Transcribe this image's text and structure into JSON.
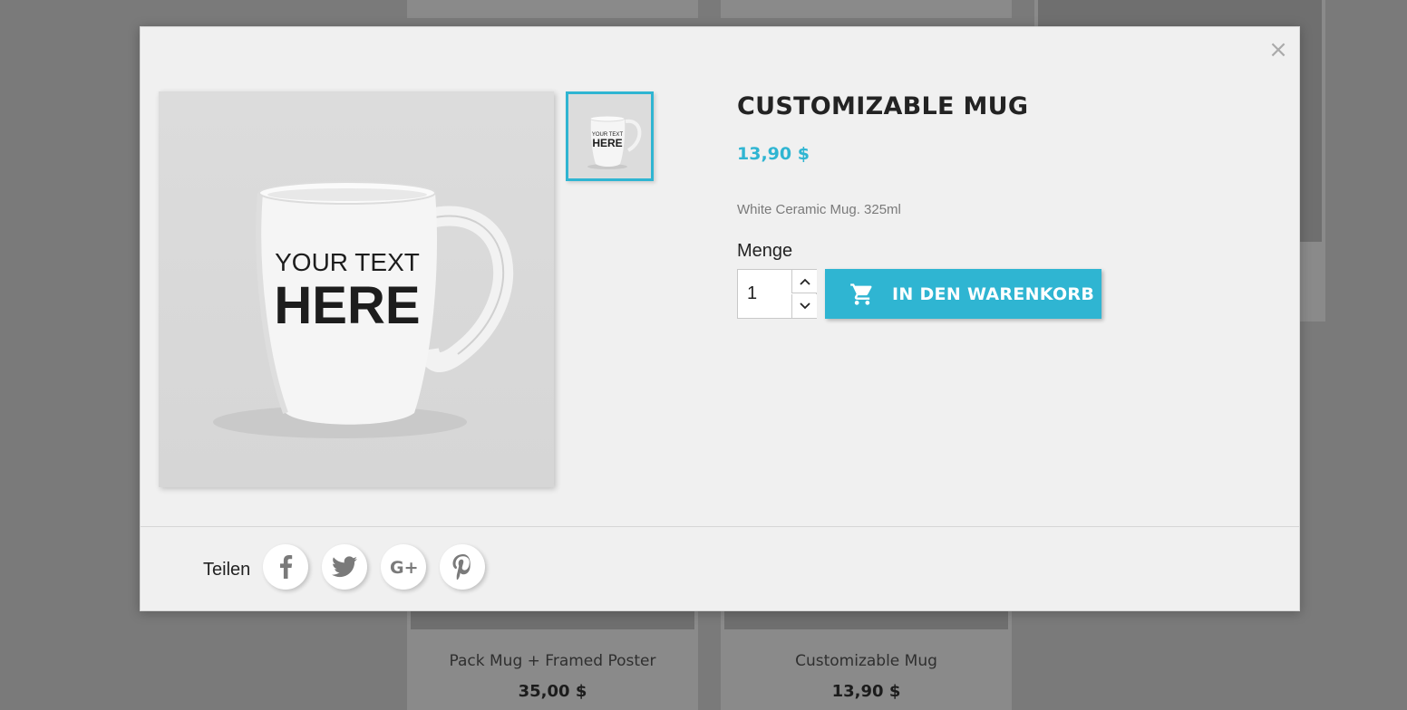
{
  "background": {
    "cards": [
      {
        "name": "Pack Mug + Framed Poster",
        "price": "35,00 $"
      },
      {
        "name": "Customizable Mug",
        "price": "13,90 $"
      }
    ]
  },
  "modal": {
    "close_label": "×",
    "title": "CUSTOMIZABLE MUG",
    "price": "13,90 $",
    "description": "White Ceramic Mug. 325ml",
    "quantity_label": "Menge",
    "quantity_value": "1",
    "add_to_cart_label": "IN DEN WARENKORB",
    "mug_text_line1": "YOUR TEXT",
    "mug_text_line2": "HERE",
    "share_label": "Teilen",
    "social_icons": [
      "facebook-icon",
      "twitter-icon",
      "google-plus-icon",
      "pinterest-icon"
    ]
  },
  "colors": {
    "accent": "#2fb5d2",
    "modal_bg": "#f0f0f0",
    "backdrop": "#7a7a7a"
  }
}
